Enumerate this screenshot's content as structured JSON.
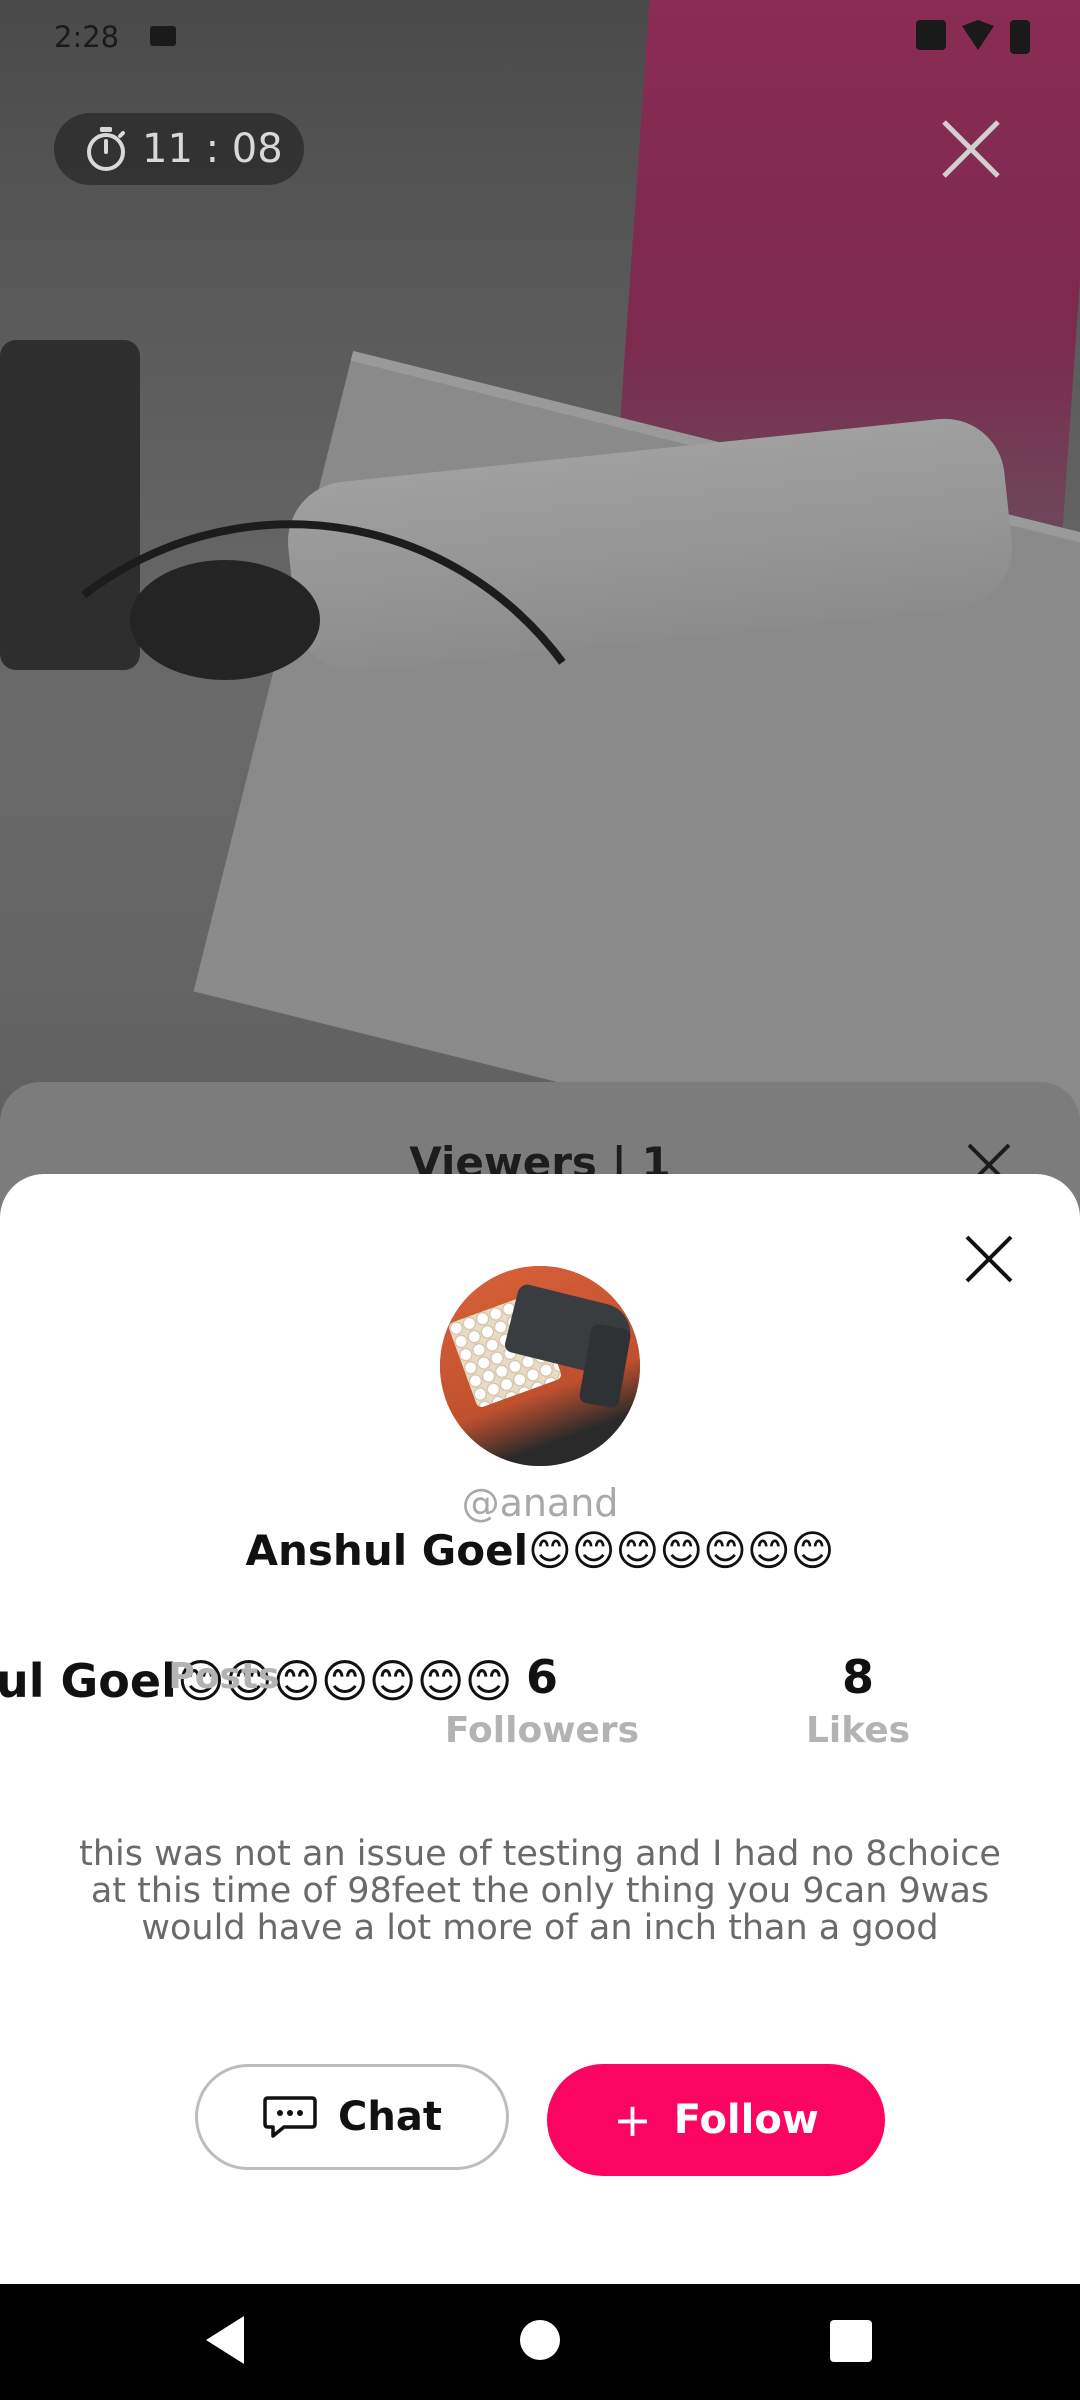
{
  "status_bar": {
    "time": "2:28"
  },
  "live": {
    "timer": "11 : 08"
  },
  "viewers_sheet": {
    "title": "Viewers | 1"
  },
  "profile": {
    "username": "@anand",
    "display_name": "Anshul Goel😊😊😊😊😊😊😊",
    "overflow_name": "ul Goel😊😊😊😊😊😊😊",
    "stats": {
      "posts": {
        "value": "",
        "label": "Posts"
      },
      "followers": {
        "value": "6",
        "label": "Followers"
      },
      "likes": {
        "value": "8",
        "label": "Likes"
      }
    },
    "bio": "this was not an issue of testing and I had no 8choice at this time of 98feet the only thing you 9can 9was would have a lot more of an inch than a good",
    "chat_label": "Chat",
    "follow_label": "Follow",
    "follow_plus": "+"
  },
  "icons": {
    "timer": "stopwatch-icon",
    "close": "close-icon",
    "chat": "chat-bubble-icon",
    "back": "nav-back-icon",
    "home": "nav-home-icon",
    "recents": "nav-recents-icon"
  },
  "colors": {
    "accent": "#fc0562",
    "sheet_bg": "#ffffff",
    "muted_text": "#a9a9a9"
  }
}
